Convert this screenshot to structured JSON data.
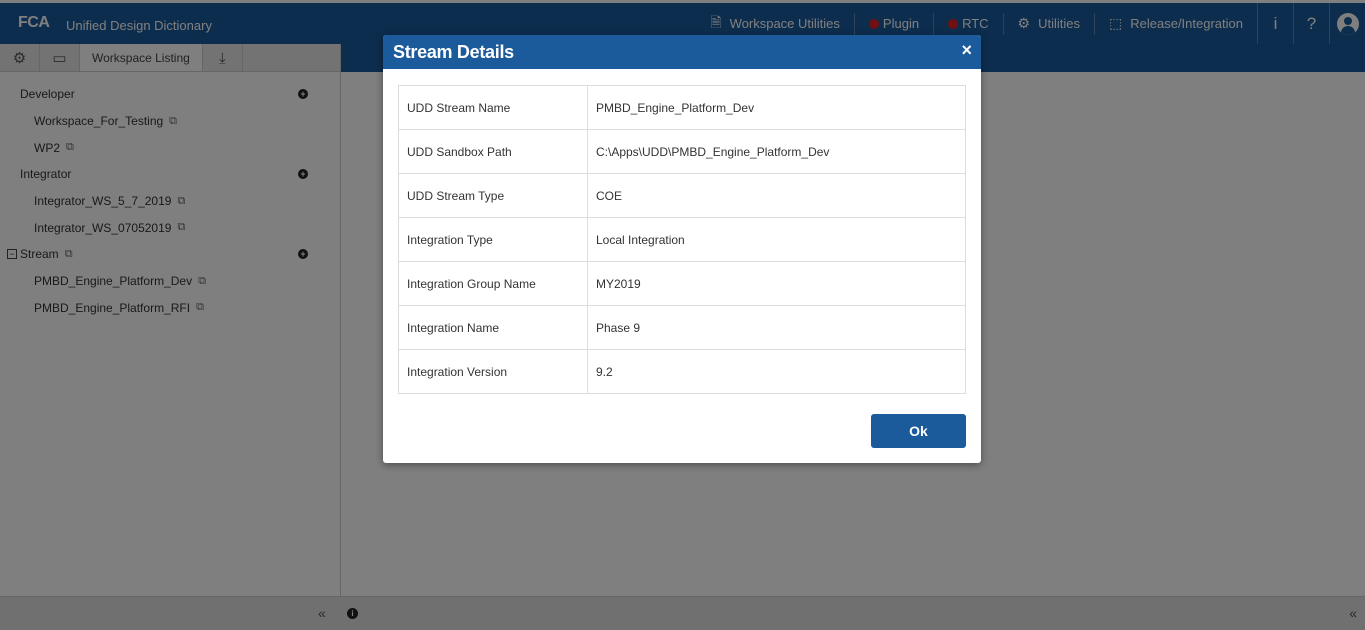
{
  "header": {
    "logo": "FCA",
    "app_title": "Unified Design Dictionary",
    "nav": [
      {
        "label": "Workspace Utilities",
        "icon": "document-icon"
      },
      {
        "label": "Plugin",
        "icon": "red-dot-icon"
      },
      {
        "label": "RTC",
        "icon": "red-dot-icon"
      },
      {
        "label": "Utilities",
        "icon": "gears-icon"
      },
      {
        "label": "Release/Integration",
        "icon": "frame-icon"
      }
    ],
    "info_label": "i",
    "help_label": "?"
  },
  "left_panel": {
    "tab_label": "Workspace Listing",
    "groups": [
      {
        "label": "Developer",
        "children": [
          "Workspace_For_Testing",
          "WP2"
        ]
      },
      {
        "label": "Integrator",
        "children": [
          "Integrator_WS_5_7_2019",
          "Integrator_WS_07052019"
        ]
      },
      {
        "label": "Stream",
        "children": [
          "PMBD_Engine_Platform_Dev",
          "PMBD_Engine_Platform_RFI"
        ]
      }
    ]
  },
  "footer": {
    "collapse_left": "«",
    "collapse_right": "«"
  },
  "modal": {
    "title": "Stream Details",
    "close": "×",
    "rows": [
      {
        "key": "UDD Stream Name",
        "value": "PMBD_Engine_Platform_Dev"
      },
      {
        "key": "UDD Sandbox Path",
        "value": "C:\\Apps\\UDD\\PMBD_Engine_Platform_Dev"
      },
      {
        "key": "UDD Stream Type",
        "value": "COE"
      },
      {
        "key": "Integration Type",
        "value": "Local Integration"
      },
      {
        "key": "Integration Group Name",
        "value": "MY2019"
      },
      {
        "key": "Integration Name",
        "value": "Phase 9"
      },
      {
        "key": "Integration Version",
        "value": "9.2"
      }
    ],
    "ok_label": "Ok"
  },
  "colors": {
    "brand_blue": "#1b5b9c",
    "status_red": "#e02020"
  }
}
